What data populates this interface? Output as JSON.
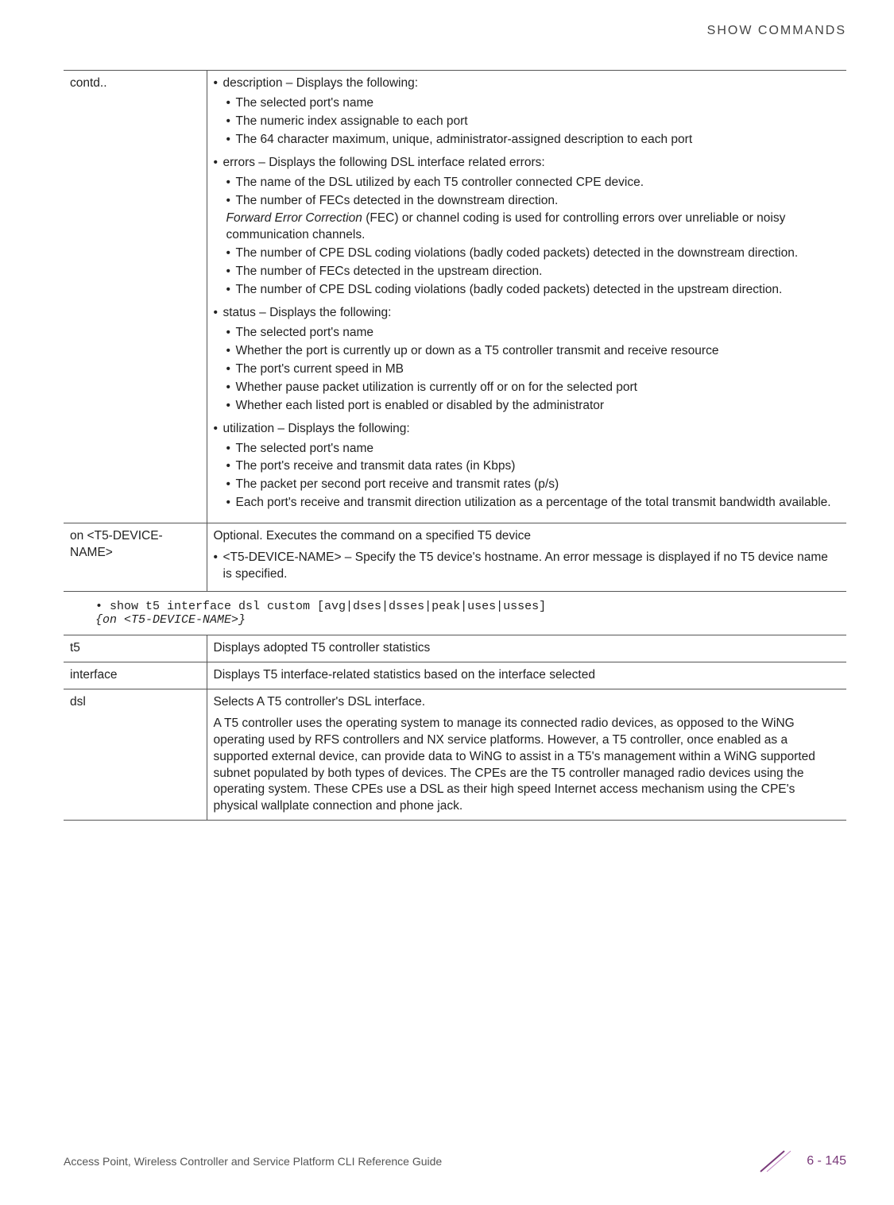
{
  "header": {
    "section": "SHOW COMMANDS"
  },
  "table1": {
    "rows": [
      {
        "param": "contd..",
        "desc": {
          "groups": [
            {
              "lead": "description – Displays the following:",
              "subs": [
                {
                  "t": "The selected port's name"
                },
                {
                  "t": "The numeric index assignable to each port"
                },
                {
                  "t": "The 64 character maximum, unique, administrator-assigned description to each port",
                  "wrap": true
                }
              ]
            },
            {
              "lead": "errors – Displays the following DSL interface related errors:",
              "subs": [
                {
                  "t": "The name of the DSL utilized by each T5 controller connected CPE device."
                },
                {
                  "t": "The number of FECs detected in the downstream direction."
                },
                {
                  "note_em": "Forward Error Correction",
                  "note_rest": " (FEC) or channel coding is used for controlling errors over unreliable or noisy communication channels."
                },
                {
                  "t": "The number of CPE DSL coding violations (badly coded packets) detected in the downstream direction.",
                  "wrap": true
                },
                {
                  "t": "The number of FECs detected in the upstream direction."
                },
                {
                  "t": "The number of CPE DSL coding violations (badly coded packets) detected in the upstream direction.",
                  "wrap": true
                }
              ]
            },
            {
              "lead": "status – Displays the following:",
              "subs": [
                {
                  "t": "The selected port's name"
                },
                {
                  "t": "Whether the port is currently up or down as a T5 controller transmit and receive resource",
                  "wrap": true
                },
                {
                  "t": "The port's current speed in MB"
                },
                {
                  "t": "Whether pause packet utilization is currently off or on for the selected port"
                },
                {
                  "t": "Whether each listed port is enabled or disabled by the administrator"
                }
              ]
            },
            {
              "lead": "utilization – Displays the following:",
              "subs": [
                {
                  "t": "The selected port's name"
                },
                {
                  "t": "The port's receive and transmit data rates (in Kbps)"
                },
                {
                  "t": "The packet per second port receive and transmit rates (p/s)"
                },
                {
                  "t": "Each port's receive and transmit direction utilization as a percentage of the total transmit bandwidth available.",
                  "wrap": true
                }
              ]
            }
          ]
        }
      },
      {
        "param": "on <T5-DEVICE-NAME>",
        "desc": {
          "plain": "Optional. Executes the command on a specified T5 device",
          "bullet": "<T5-DEVICE-NAME> – Specify the T5 device's hostname. An error message is displayed if no T5 device name is specified."
        }
      }
    ]
  },
  "code": {
    "line1": "• show t5 interface dsl custom [avg|dses|dsses|peak|uses|usses]",
    "line2": "{on <T5-DEVICE-NAME>}"
  },
  "table2": {
    "rows": [
      {
        "param": "t5",
        "desc": "Displays adopted T5 controller statistics"
      },
      {
        "param": "interface",
        "desc": "Displays T5 interface-related statistics based on the interface selected"
      },
      {
        "param": "dsl",
        "desc1": "Selects A T5 controller's DSL interface.",
        "desc2": "A T5 controller uses the operating system to manage its connected radio devices, as opposed to the WiNG operating used by RFS controllers and NX service platforms. However, a T5 controller, once enabled as a supported external device, can provide data to WiNG to assist in a T5's management within a WiNG supported subnet populated by both types of devices. The CPEs are the T5 controller managed radio devices using the operating system. These CPEs use a DSL as their high speed Internet access mechanism using the CPE's physical wallplate connection and phone jack."
      }
    ]
  },
  "footer": {
    "left": "Access Point, Wireless Controller and Service Platform CLI Reference Guide",
    "page": "6 - 145"
  }
}
